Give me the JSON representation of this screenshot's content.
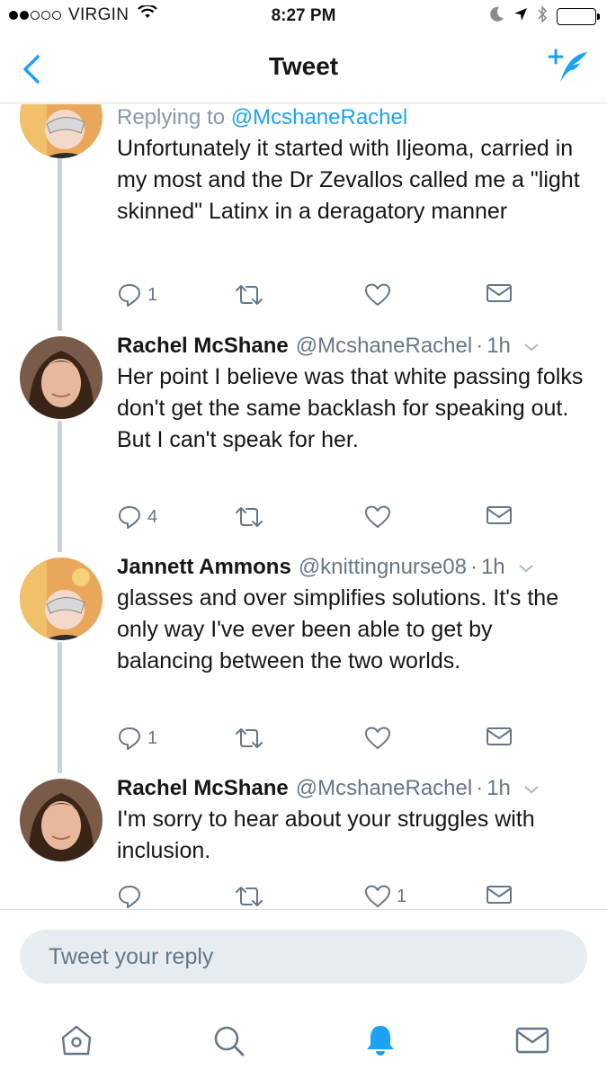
{
  "status_bar": {
    "carrier": "VIRGIN",
    "time": "8:27 PM",
    "signal_dots_filled": 2,
    "signal_dots_total": 5
  },
  "nav": {
    "title": "Tweet",
    "back_icon": "chevron-left-icon",
    "compose_icon": "compose-tweet-icon",
    "accent_color": "#1da1f2"
  },
  "tweets": [
    {
      "replying_prefix": "Replying to",
      "replying_handle": "@McshaneRachel",
      "text": "Unfortunately it started with Iljeoma, carried in my most and the  Dr Zevallos called me a \"light skinned\" Latinx in a deragatory manner",
      "reply_count": "1",
      "retweet_count": "",
      "like_count": ""
    },
    {
      "name": "Rachel McShane",
      "handle": "@McshaneRachel",
      "separator": "·",
      "time": "1h",
      "text": "Her point I believe was that white passing folks don't get the same backlash for speaking out. But I can't speak for her.",
      "reply_count": "4",
      "retweet_count": "",
      "like_count": ""
    },
    {
      "name": "Jannett Ammons",
      "handle": "@knittingnurse08",
      "separator": "·",
      "time": "1h",
      "text": "glasses and over simplifies solutions. It's the only way I've ever been able to get by balancing between the two worlds.",
      "reply_count": "1",
      "retweet_count": "",
      "like_count": ""
    },
    {
      "name": "Rachel McShane",
      "handle": "@McshaneRachel",
      "separator": "·",
      "time": "1h",
      "text": "I'm sorry to hear about your struggles with inclusion.",
      "reply_count": "",
      "retweet_count": "",
      "like_count": "1"
    }
  ],
  "reply_bar": {
    "placeholder": "Tweet your reply"
  },
  "tab_bar": {
    "items": [
      "home-icon",
      "search-icon",
      "notifications-icon",
      "messages-icon"
    ],
    "active": "notifications-icon"
  }
}
